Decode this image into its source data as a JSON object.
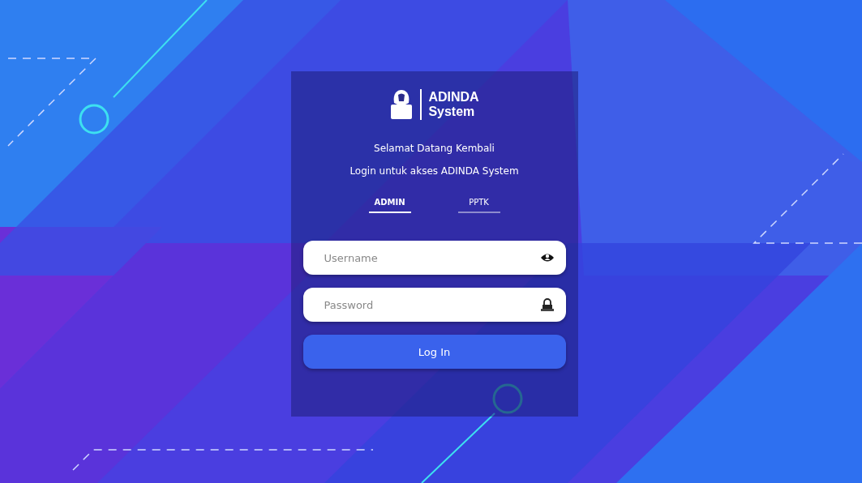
{
  "brand": {
    "line_1": "ADINDA",
    "line_2": "System"
  },
  "welcome": "Selamat Datang Kembali",
  "subtitle": "Login untuk akses ADINDA System",
  "tabs": [
    {
      "label": "ADMIN",
      "selected": true
    },
    {
      "label": "PPTK",
      "selected": false
    }
  ],
  "username": {
    "placeholder": "Username"
  },
  "password": {
    "placeholder": "Password"
  },
  "login_button": "Log In"
}
